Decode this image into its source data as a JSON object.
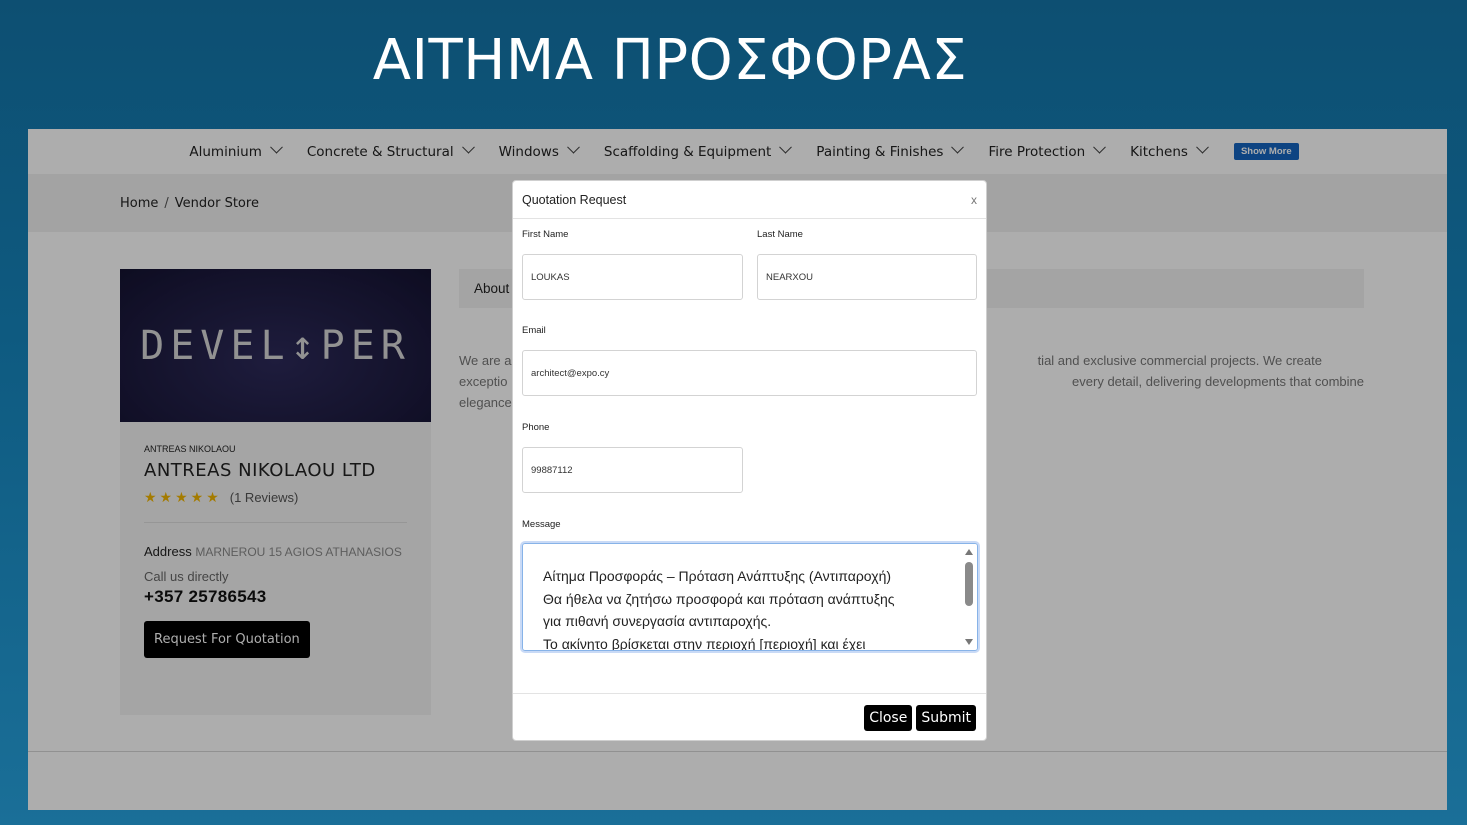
{
  "slide": {
    "title": "ΑΙΤΗΜΑ ΠΡΟΣΦΟΡΑΣ"
  },
  "nav": {
    "items": [
      {
        "label": "Aluminium"
      },
      {
        "label": "Concrete & Structural"
      },
      {
        "label": "Windows"
      },
      {
        "label": "Scaffolding & Equipment"
      },
      {
        "label": "Painting & Finishes"
      },
      {
        "label": "Fire Protection"
      },
      {
        "label": "Kitchens"
      }
    ],
    "show_more": "Show More"
  },
  "breadcrumb": {
    "home": "Home",
    "separator": "/",
    "current": "Vendor Store"
  },
  "vendor": {
    "logo_text": "DEVEL↕PER",
    "owner": "ANTREAS NIKOLAOU",
    "company": "ANTREAS NIKOLAOU LTD",
    "stars": "★★★★★",
    "rating": 5,
    "reviews": "(1 Reviews)",
    "address_label": "Address",
    "address_value": "MARNEROU 15 AGIOS ATHANASIOS",
    "call_label": "Call us directly",
    "phone": "+357 25786543",
    "rfq_button": "Request For Quotation"
  },
  "about": {
    "tab_label": "About",
    "text_left_1": "We are a",
    "text_left_2": "exceptio",
    "text_left_3": "elegance",
    "text_right_1": "tial and exclusive commercial projects. We create",
    "text_right_2": "every detail, delivering developments that combine"
  },
  "modal": {
    "title": "Quotation Request",
    "close_x": "x",
    "first_name_label": "First Name",
    "first_name_value": "LOUKAS",
    "last_name_label": "Last Name",
    "last_name_value": "NEARXOU",
    "email_label": "Email",
    "email_value": "architect@expo.cy",
    "phone_label": "Phone",
    "phone_value": "99887112",
    "message_label": "Message",
    "message_lines": [
      "Αίτημα Προσφοράς – Πρόταση Ανάπτυξης (Αντιπαροχή)",
      "Θα ήθελα να ζητήσω προσφορά και πρόταση ανάπτυξης",
      "για πιθανή συνεργασία αντιπαροχής.",
      "Το ακίνητο βρίσκεται στην περιοχή [περιοχή] και έχει"
    ],
    "close_button": "Close",
    "submit_button": "Submit"
  }
}
